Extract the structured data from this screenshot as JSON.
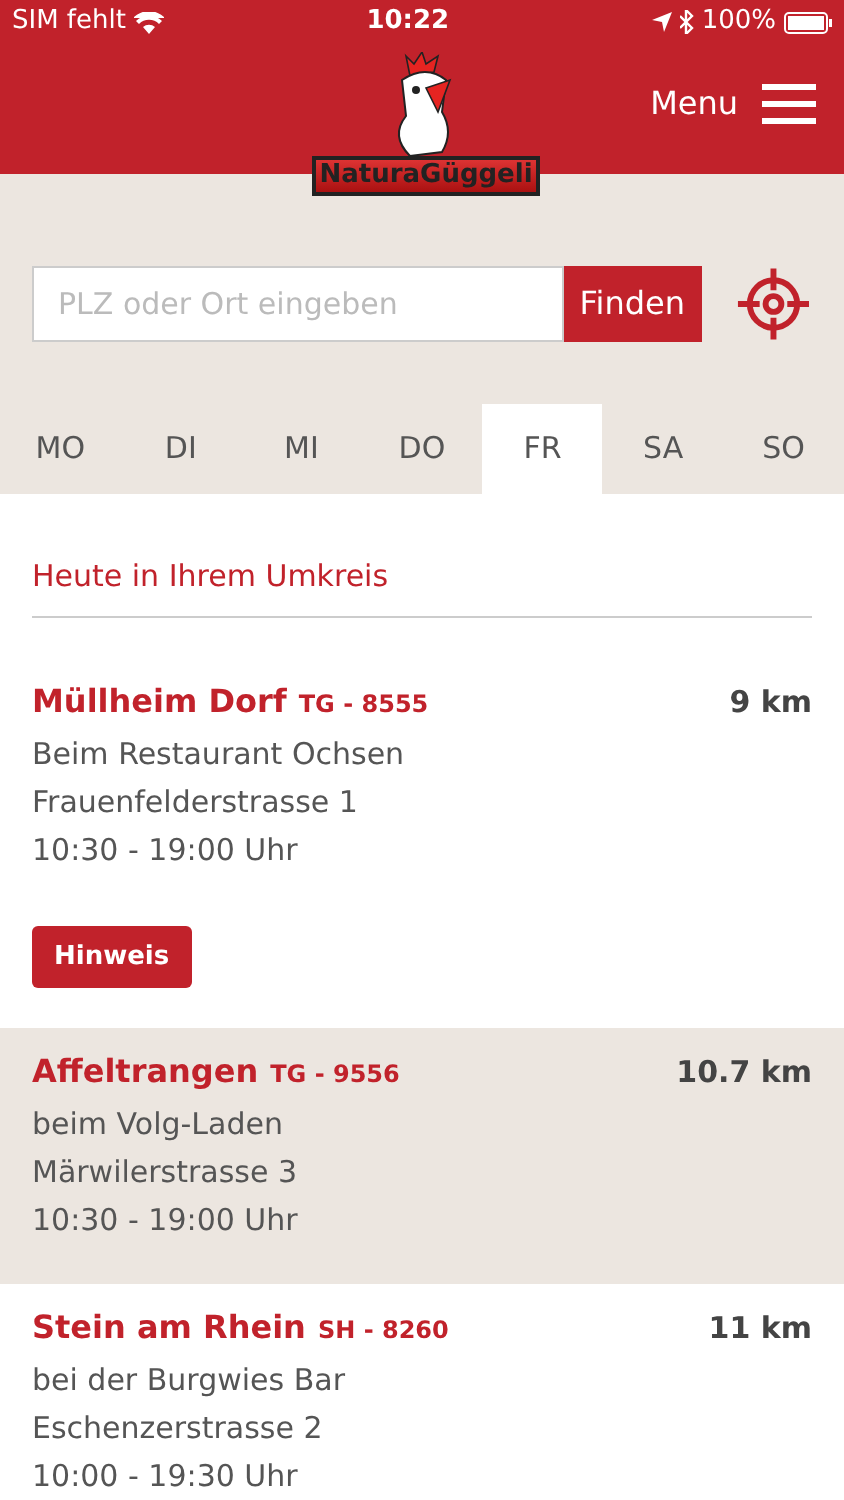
{
  "status_bar": {
    "carrier": "SIM fehlt",
    "time": "10:22",
    "battery": "100%"
  },
  "header": {
    "logo_text": "NaturaGüggeli",
    "menu_label": "Menu"
  },
  "search": {
    "placeholder": "PLZ oder Ort eingeben",
    "button": "Finden"
  },
  "days": [
    {
      "label": "MO",
      "selected": false
    },
    {
      "label": "DI",
      "selected": false
    },
    {
      "label": "MI",
      "selected": false
    },
    {
      "label": "DO",
      "selected": false
    },
    {
      "label": "FR",
      "selected": true
    },
    {
      "label": "SA",
      "selected": false
    },
    {
      "label": "SO",
      "selected": false
    }
  ],
  "section_title": "Heute in Ihrem Umkreis",
  "locations": [
    {
      "name": "Müllheim Dorf",
      "region": "TG - 8555",
      "distance": "9 km",
      "place": "Beim Restaurant Ochsen",
      "street": "Frauenfelderstrasse 1",
      "hours": "10:30 - 19:00 Uhr",
      "note_button": "Hinweis",
      "shaded": false
    },
    {
      "name": "Affeltrangen",
      "region": "TG - 9556",
      "distance": "10.7 km",
      "place": "beim Volg-Laden",
      "street": "Märwilerstrasse 3",
      "hours": "10:30 - 19:00 Uhr",
      "shaded": true
    },
    {
      "name": "Stein am Rhein",
      "region": "SH - 8260",
      "distance": "11 km",
      "place": "bei der Burgwies Bar",
      "street": "Eschenzerstrasse 2",
      "hours": "10:00 - 19:30 Uhr",
      "shaded": false
    }
  ]
}
